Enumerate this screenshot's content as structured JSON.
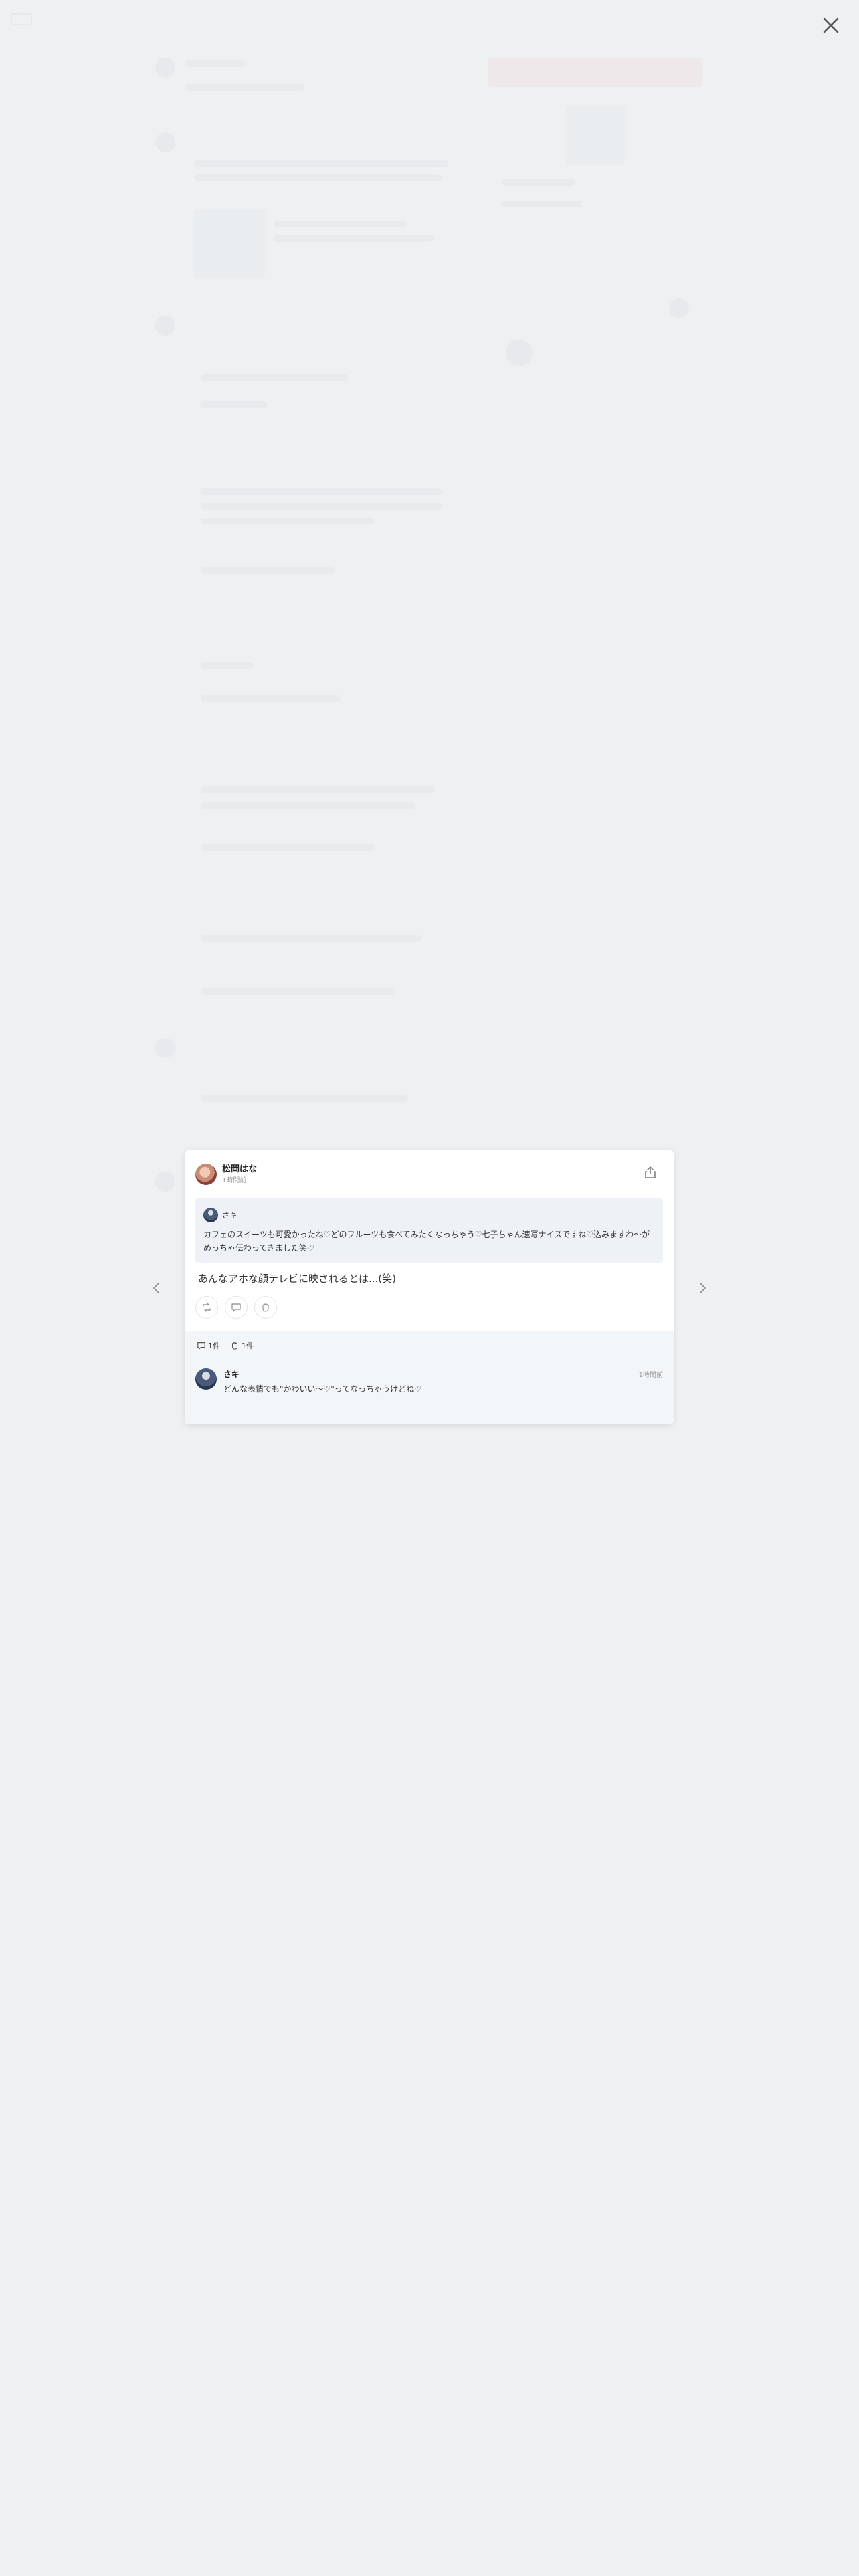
{
  "header": {
    "close_label": "close"
  },
  "post": {
    "author": "松岡はな",
    "time": "1時間前",
    "quote": {
      "author": "さキ",
      "text": "カフェのスイーツも可愛かったね♡どのフルーツも食べてみたくなっちゃう♡七子ちゃん速写ナイスですね♡込みますわ〜がめっちゃ伝わってきました笑♡"
    },
    "comment": "あんなアホな顔テレビに映されるとは...(笑)",
    "actions": [
      "repost",
      "comment",
      "like"
    ]
  },
  "stats": {
    "repost_count": "1件",
    "like_count": "1件"
  },
  "reply": {
    "author": "さキ",
    "time": "1時間前",
    "text": "どんな表情でも\"かわいい〜♡\"ってなっちゃうけどね♡"
  },
  "icons": [
    "close-icon",
    "share-icon",
    "chevron-left-icon",
    "chevron-right-icon",
    "repost-icon",
    "comment-icon",
    "like-icon"
  ],
  "colors": {
    "background": "#f1f2f4",
    "modal": "#ffffff",
    "quote_bg": "#eef2f6",
    "replies_bg": "#f3f6f9"
  }
}
